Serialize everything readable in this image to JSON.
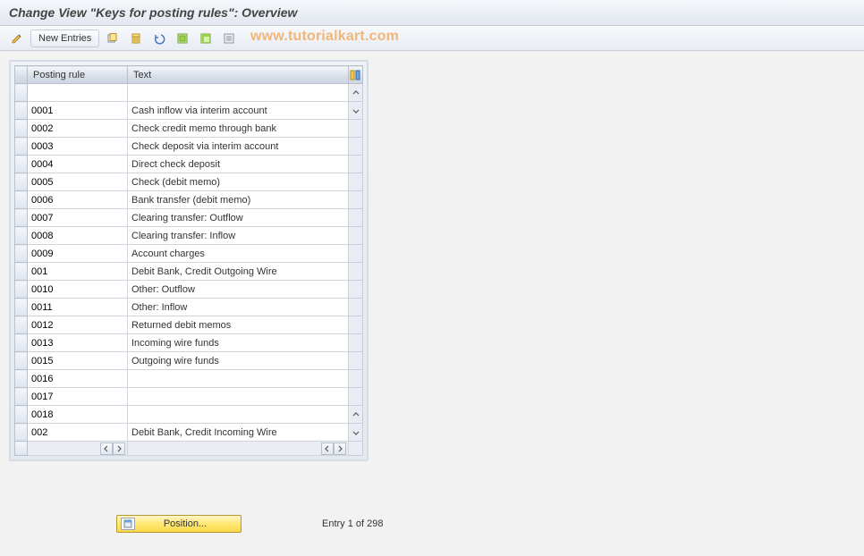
{
  "title": "Change View \"Keys for posting rules\": Overview",
  "toolbar": {
    "new_entries_label": "New Entries"
  },
  "watermark": "www.tutorialkart.com",
  "grid": {
    "columns": {
      "rule": "Posting rule",
      "text": "Text"
    },
    "rows": [
      {
        "rule": "",
        "text": ""
      },
      {
        "rule": "0001",
        "text": "Cash inflow via interim account"
      },
      {
        "rule": "0002",
        "text": "Check credit memo through bank"
      },
      {
        "rule": "0003",
        "text": "Check deposit via interim account"
      },
      {
        "rule": "0004",
        "text": "Direct check deposit"
      },
      {
        "rule": "0005",
        "text": "Check (debit memo)"
      },
      {
        "rule": "0006",
        "text": "Bank transfer (debit memo)"
      },
      {
        "rule": "0007",
        "text": "Clearing transfer: Outflow"
      },
      {
        "rule": "0008",
        "text": "Clearing transfer: Inflow"
      },
      {
        "rule": "0009",
        "text": "Account charges"
      },
      {
        "rule": "001",
        "text": "Debit Bank, Credit Outgoing Wire"
      },
      {
        "rule": "0010",
        "text": "Other: Outflow"
      },
      {
        "rule": "0011",
        "text": "Other: Inflow"
      },
      {
        "rule": "0012",
        "text": "Returned debit memos"
      },
      {
        "rule": "0013",
        "text": "Incoming wire funds"
      },
      {
        "rule": "0015",
        "text": "Outgoing wire funds"
      },
      {
        "rule": "0016",
        "text": ""
      },
      {
        "rule": "0017",
        "text": ""
      },
      {
        "rule": "0018",
        "text": ""
      },
      {
        "rule": "002",
        "text": "Debit Bank, Credit Incoming Wire"
      }
    ]
  },
  "footer": {
    "position_label": "Position...",
    "entry_text": "Entry 1 of 298"
  }
}
